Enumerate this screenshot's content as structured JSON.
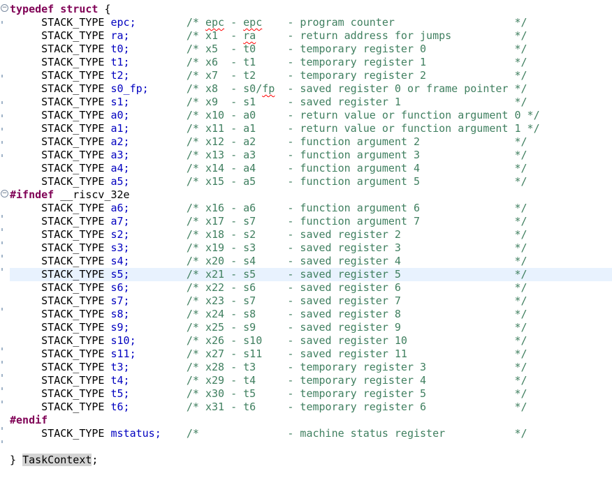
{
  "editor": {
    "typedef_kw": "typedef",
    "struct_kw": "struct",
    "open_brace": " {",
    "type_name": "STACK_TYPE",
    "ifndef_kw": "#ifndef",
    "ifndef_macro": "__riscv_32e",
    "endif_kw": "#endif",
    "close_brace": "} ",
    "struct_name": "TaskContext",
    "semicolon": ";",
    "fields": [
      {
        "name": "epc;",
        "comment": "/* epc - epc    - program counter                   */"
      },
      {
        "name": "ra;",
        "comment": "/* x1  - ra     - return address for jumps          */"
      },
      {
        "name": "t0;",
        "comment": "/* x5  - t0     - temporary register 0              */"
      },
      {
        "name": "t1;",
        "comment": "/* x6  - t1     - temporary register 1              */"
      },
      {
        "name": "t2;",
        "comment": "/* x7  - t2     - temporary register 2              */"
      },
      {
        "name": "s0_fp;",
        "comment": "/* x8  - s0/fp  - saved register 0 or frame pointer */"
      },
      {
        "name": "s1;",
        "comment": "/* x9  - s1     - saved register 1                  */"
      },
      {
        "name": "a0;",
        "comment": "/* x10 - a0     - return value or function argument 0 */"
      },
      {
        "name": "a1;",
        "comment": "/* x11 - a1     - return value or function argument 1 */"
      },
      {
        "name": "a2;",
        "comment": "/* x12 - a2     - function argument 2               */"
      },
      {
        "name": "a3;",
        "comment": "/* x13 - a3     - function argument 3               */"
      },
      {
        "name": "a4;",
        "comment": "/* x14 - a4     - function argument 4               */"
      },
      {
        "name": "a5;",
        "comment": "/* x15 - a5     - function argument 5               */"
      },
      {
        "name": "a6;",
        "comment": "/* x16 - a6     - function argument 6               */"
      },
      {
        "name": "a7;",
        "comment": "/* x17 - s7     - function argument 7               */"
      },
      {
        "name": "s2;",
        "comment": "/* x18 - s2     - saved register 2                  */"
      },
      {
        "name": "s3;",
        "comment": "/* x19 - s3     - saved register 3                  */"
      },
      {
        "name": "s4;",
        "comment": "/* x20 - s4     - saved register 4                  */"
      },
      {
        "name": "s5;",
        "comment": "/* x21 - s5     - saved register 5                  */"
      },
      {
        "name": "s6;",
        "comment": "/* x22 - s6     - saved register 6                  */"
      },
      {
        "name": "s7;",
        "comment": "/* x23 - s7     - saved register 7                  */"
      },
      {
        "name": "s8;",
        "comment": "/* x24 - s8     - saved register 8                  */"
      },
      {
        "name": "s9;",
        "comment": "/* x25 - s9     - saved register 9                  */"
      },
      {
        "name": "s10;",
        "comment": "/* x26 - s10    - saved register 10                 */"
      },
      {
        "name": "s11;",
        "comment": "/* x27 - s11    - saved register 11                 */"
      },
      {
        "name": "t3;",
        "comment": "/* x28 - t3     - temporary register 3              */"
      },
      {
        "name": "t4;",
        "comment": "/* x29 - t4     - temporary register 4              */"
      },
      {
        "name": "t5;",
        "comment": "/* x30 - t5     - temporary register 5              */"
      },
      {
        "name": "t6;",
        "comment": "/* x31 - t6     - temporary register 6              */"
      },
      {
        "name": "mstatus;",
        "comment": "/*              - machine status register           */"
      }
    ]
  }
}
